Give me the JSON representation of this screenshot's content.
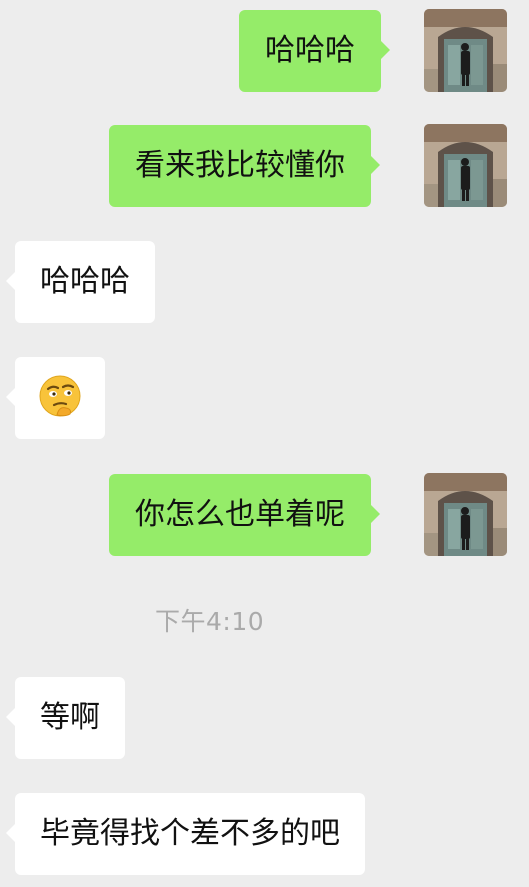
{
  "messages": [
    {
      "side": "out",
      "text": "哈哈哈"
    },
    {
      "side": "out",
      "text": "看来我比较懂你"
    },
    {
      "side": "in",
      "text": "哈哈哈"
    },
    {
      "side": "in",
      "emoji": "thinking-face-emoji"
    },
    {
      "side": "out",
      "text": "你怎么也单着呢"
    },
    {
      "timestamp": "下午4:10"
    },
    {
      "side": "in",
      "text": "等啊"
    },
    {
      "side": "in",
      "text": "毕竟得找个差不多的吧"
    }
  ],
  "colors": {
    "background": "#ededed",
    "outgoing_bubble": "#95ec69",
    "incoming_bubble": "#ffffff",
    "timestamp_text": "#aaaaaa"
  }
}
